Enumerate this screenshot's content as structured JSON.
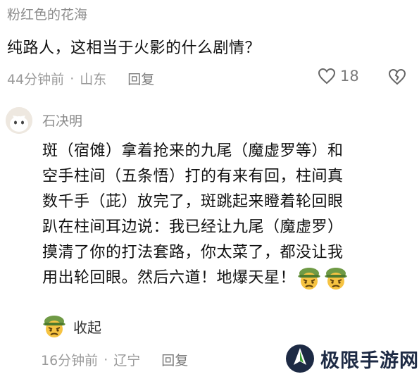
{
  "comment1": {
    "username": "粉红色的花海",
    "text": "纯路人，这相当于火影的什么剧情？",
    "time": "44分钟前",
    "dot": "·",
    "location": "山东",
    "reply_label": "回复",
    "like_count": "18"
  },
  "comment2": {
    "username": "石决明",
    "lines": [
      "斑（宿傩）拿着抢来的九尾（魔虚罗等）和",
      "空手柱间（五条悟）打的有来有回，柱间真",
      "数千手（茈）放完了，斑跳起来瞪着轮回眼",
      "趴在柱间耳边说：我已经让九尾（魔虚罗）",
      "摸清了你的打法套路，你太菜了，都没让我",
      "用出轮回眼。然后六道！地爆天星！"
    ],
    "collapse_label": "收起",
    "time": "16分钟前",
    "dot": "·",
    "location": "辽宁",
    "reply_label": "回复"
  },
  "watermark": {
    "text": "极限手游网"
  }
}
